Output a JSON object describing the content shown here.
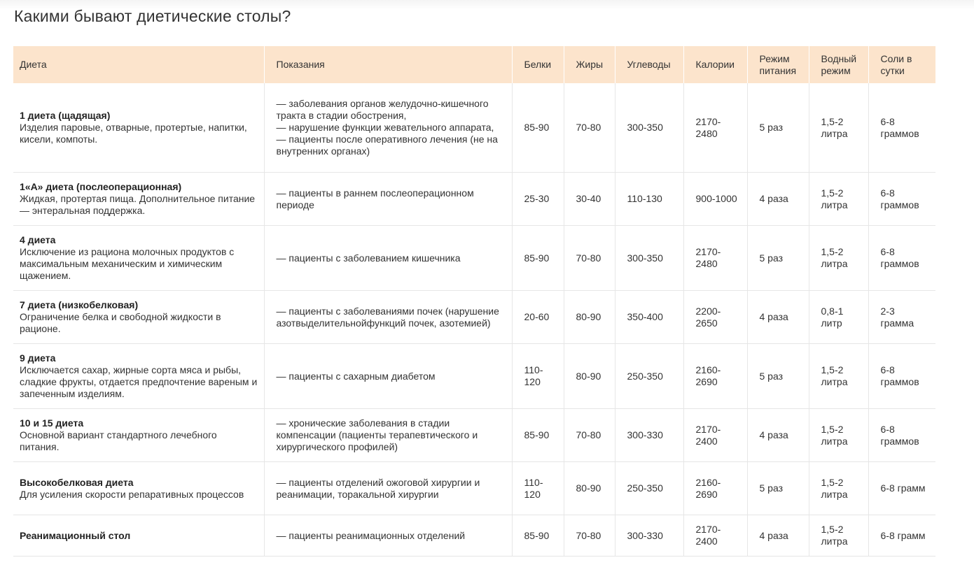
{
  "title": "Какими бывают диетические столы?",
  "table": {
    "headers": [
      "Диета",
      "Показания",
      "Белки",
      "Жиры",
      "Углеводы",
      "Калории",
      "Режим питания",
      "Водный режим",
      "Соли в сутки"
    ],
    "rows": [
      {
        "name": "1 диета (щадящая)",
        "desc": "Изделия паровые, отварные, протертые, напитки, кисели, компоты.",
        "indications": "— заболевания органов желудочно-кишечного тракта в стадии обострения,\n— нарушение функции жевательного аппарата,\n— пациенты после оперативного лечения (не на внутренних органах)",
        "protein": "85-90",
        "fat": "70-80",
        "carbs": "300-350",
        "calories": "2170-2480",
        "meals": "5 раз",
        "water": "1,5-2 литра",
        "salt": "6-8 граммов"
      },
      {
        "name": "1«А» диета (послеоперационная)",
        "desc": "Жидкая, протертая пища. Дополнительное питание — энтеральная поддержка.",
        "indications": "— пациенты в раннем послеоперационном периоде",
        "protein": "25-30",
        "fat": "30-40",
        "carbs": "110-130",
        "calories": "900-1000",
        "meals": "4 раза",
        "water": "1,5-2 литра",
        "salt": "6-8 граммов"
      },
      {
        "name": "4 диета",
        "desc": "Исключение из рациона молочных продуктов с максимальным механическим и химическим щажением.",
        "indications": "— пациенты с заболеванием кишечника",
        "protein": "85-90",
        "fat": "70-80",
        "carbs": "300-350",
        "calories": "2170-2480",
        "meals": "5 раз",
        "water": "1,5-2 литра",
        "salt": "6-8 граммов"
      },
      {
        "name": "7 диета (низкобелковая)",
        "desc": "Ограничение белка и свободной жидкости в рационе.",
        "indications": "— пациенты с заболеваниями почек (нарушение азотвыделительнойфункций почек, азотемией)",
        "protein": "20-60",
        "fat": "80-90",
        "carbs": "350-400",
        "calories": "2200-2650",
        "meals": "4 раза",
        "water": "0,8-1 литр",
        "salt": "2-3 грамма"
      },
      {
        "name": "9 диета",
        "desc": "Исключается сахар, жирные сорта мяса и рыбы, сладкие фрукты, отдается предпочтение вареным и запеченным изделиям.",
        "indications": "— пациенты с сахарным диабетом",
        "protein": "110-120",
        "fat": "80-90",
        "carbs": "250-350",
        "calories": "2160-2690",
        "meals": "5 раз",
        "water": "1,5-2 литра",
        "salt": "6-8 граммов"
      },
      {
        "name": "10 и 15 диета",
        "desc": "Основной вариант стандартного лечебного питания.",
        "indications": "— хронические заболевания в стадии компенсации (пациенты терапевтического и хирургического профилей)",
        "protein": "85-90",
        "fat": "70-80",
        "carbs": "300-330",
        "calories": "2170-2400",
        "meals": "4 раза",
        "water": "1,5-2 литра",
        "salt": "6-8 граммов"
      },
      {
        "name": "Высокобелковая диета",
        "desc": "Для усиления скорости репаративных процессов",
        "indications": "— пациенты отделений ожоговой хирургии и реанимации, торакальной хирургии",
        "protein": "110-120",
        "fat": "80-90",
        "carbs": "250-350",
        "calories": "2160-2690",
        "meals": "5 раз",
        "water": "1,5-2 литра",
        "salt": "6-8 грамм"
      },
      {
        "name": "Реанимационный стол",
        "desc": "",
        "indications": "— пациенты реанимационных отделений",
        "protein": "85-90",
        "fat": "70-80",
        "carbs": "300-330",
        "calories": "2170-2400",
        "meals": "4 раза",
        "water": "1,5-2 литра",
        "salt": "6-8 грамм"
      }
    ]
  }
}
